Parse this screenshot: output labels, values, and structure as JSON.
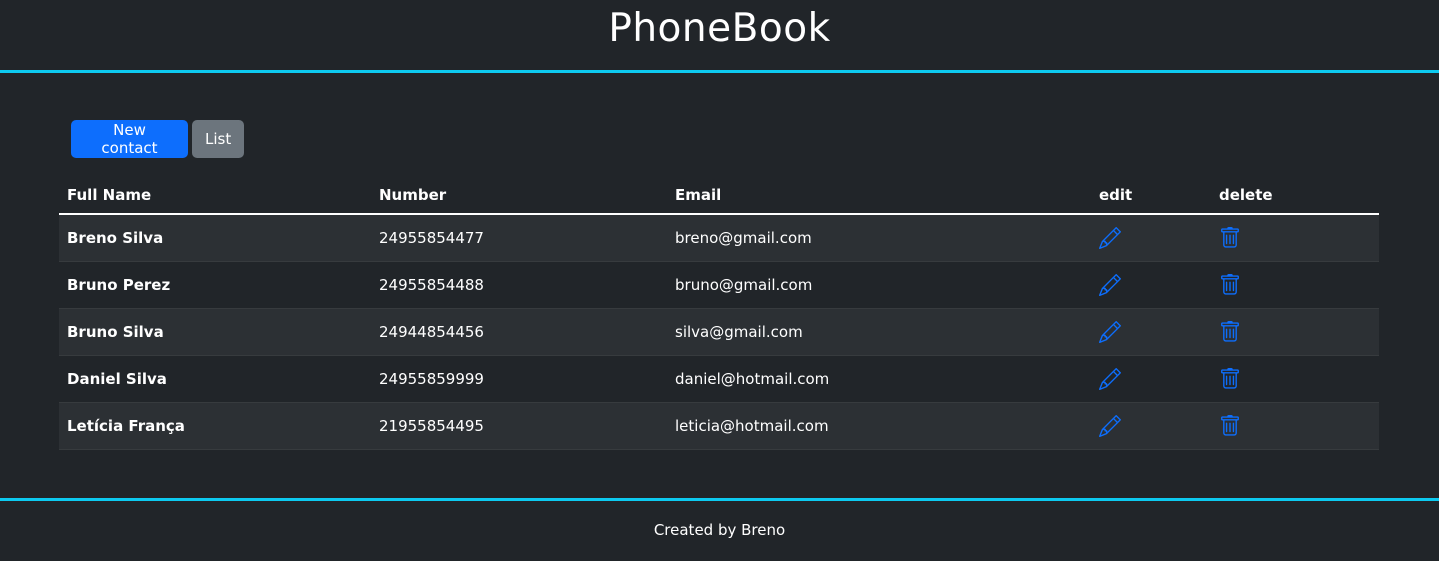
{
  "app": {
    "title": "PhoneBook"
  },
  "toolbar": {
    "new_contact_label": "New contact",
    "list_label": "List"
  },
  "table": {
    "headers": {
      "name": "Full Name",
      "number": "Number",
      "email": "Email",
      "edit": "edit",
      "delete": "delete"
    },
    "rows": [
      {
        "name": "Breno Silva",
        "number": "24955854477",
        "email": "breno@gmail.com"
      },
      {
        "name": "Bruno Perez",
        "number": "24955854488",
        "email": "bruno@gmail.com"
      },
      {
        "name": "Bruno Silva",
        "number": "24944854456",
        "email": "silva@gmail.com"
      },
      {
        "name": "Daniel Silva",
        "number": "24955859999",
        "email": "daniel@hotmail.com"
      },
      {
        "name": "Letícia França",
        "number": "21955854495",
        "email": "leticia@hotmail.com"
      }
    ],
    "edit_icon": "pencil-icon",
    "delete_icon": "trash-icon"
  },
  "footer": {
    "text": "Created by Breno"
  },
  "colors": {
    "background": "#212529",
    "accent": "#0dcaf0",
    "primary": "#0d6efd",
    "secondary": "#6c757d",
    "stripe": "#2c3034"
  }
}
